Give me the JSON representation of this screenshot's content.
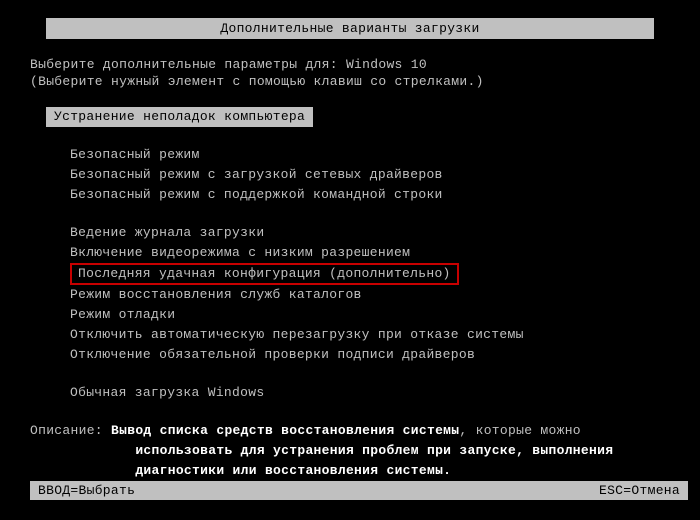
{
  "header": {
    "title": "Дополнительные варианты загрузки"
  },
  "instruction": {
    "line1": "Выберите дополнительные параметры для: Windows 10",
    "line2": "(Выберите нужный элемент с помощью клавиш со стрелками.)"
  },
  "selected_option": "Устранение неполадок компьютера",
  "group1": [
    "Безопасный режим",
    "Безопасный режим с загрузкой сетевых драйверов",
    "Безопасный режим с поддержкой командной строки"
  ],
  "group2": [
    "Ведение журнала загрузки",
    "Включение видеорежима с низким разрешением",
    "Последняя удачная конфигурация (дополнительно)",
    "Режим восстановления служб каталогов",
    "Режим отладки",
    "Отключить автоматическую перезагрузку при отказе системы",
    "Отключение обязательной проверки подписи драйверов"
  ],
  "group3": [
    "Обычная загрузка Windows"
  ],
  "highlighted_index": 2,
  "description": {
    "label": "Описание:",
    "line1": "Вывод списка средств восстановления системы",
    "line1_suffix": ", которые можно",
    "line2": "использовать для устранения проблем при запуске, выполнения",
    "line3": "диагностики или восстановления системы."
  },
  "footer": {
    "enter": "ВВОД=Выбрать",
    "esc": "ESC=Отмена"
  }
}
